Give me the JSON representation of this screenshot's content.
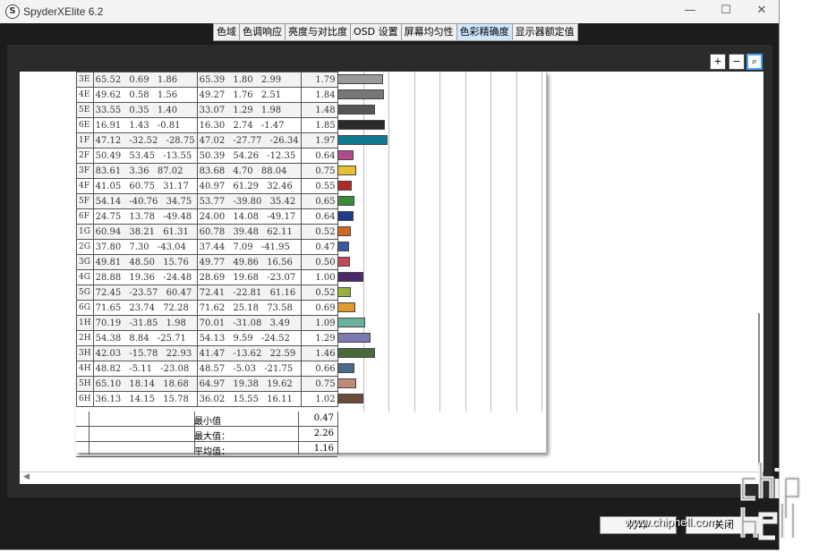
{
  "window": {
    "title": "SpyderXElite 6.2",
    "icon_letter": "S",
    "min": "—",
    "max": "☐",
    "close": "✕"
  },
  "tabs": [
    "色域",
    "色调响应",
    "亮度与对比度",
    "OSD 设置",
    "屏幕均匀性",
    "色彩精确度",
    "显示器额定值"
  ],
  "active_tab": 5,
  "zoom_buttons": [
    "+",
    "−",
    "⌕"
  ],
  "rows": [
    {
      "id": "3E",
      "n1": "65.52 0.69 1.86",
      "n2": "65.39 1.80 2.99",
      "de": "1.79",
      "color": "#9a9a9a"
    },
    {
      "id": "4E",
      "n1": "49.62 0.58 1.56",
      "n2": "49.27 1.76 2.51",
      "de": "1.84",
      "color": "#777777"
    },
    {
      "id": "5E",
      "n1": "33.55 0.35 1.40",
      "n2": "33.07 1.29 1.98",
      "de": "1.48",
      "color": "#555555"
    },
    {
      "id": "6E",
      "n1": "16.91 1.43 -0.81",
      "n2": "16.30 2.74 -1.47",
      "de": "1.85",
      "color": "#2a2a2a"
    },
    {
      "id": "1F",
      "n1": "47.12 -32.52 -28.75",
      "n2": "47.02 -27.77 -26.34",
      "de": "1.97",
      "color": "#0f7a90"
    },
    {
      "id": "2F",
      "n1": "50.49 53.45 -13.55",
      "n2": "50.39 54.26 -12.35",
      "de": "0.64",
      "color": "#b04a8a"
    },
    {
      "id": "3F",
      "n1": "83.61 3.36 87.02",
      "n2": "83.68 4.70 88.04",
      "de": "0.75",
      "color": "#e8c030"
    },
    {
      "id": "4F",
      "n1": "41.05 60.75 31.17",
      "n2": "40.97 61.29 32.46",
      "de": "0.55",
      "color": "#b02a2a"
    },
    {
      "id": "5F",
      "n1": "54.14 -40.76 34.75",
      "n2": "53.77 -39.80 35.42",
      "de": "0.65",
      "color": "#3a8a3a"
    },
    {
      "id": "6F",
      "n1": "24.75 13.78 -49.48",
      "n2": "24.00 14.08 -49.17",
      "de": "0.64",
      "color": "#1f3a8a"
    },
    {
      "id": "1G",
      "n1": "60.94 38.21 61.31",
      "n2": "60.78 39.48 62.11",
      "de": "0.52",
      "color": "#d06a20"
    },
    {
      "id": "2G",
      "n1": "37.80 7.30 -43.04",
      "n2": "37.44 7.09 -41.95",
      "de": "0.47",
      "color": "#3a5aa0"
    },
    {
      "id": "3G",
      "n1": "49.81 48.50 15.76",
      "n2": "49.77 49.86 16.56",
      "de": "0.50",
      "color": "#c04a5a"
    },
    {
      "id": "4G",
      "n1": "28.88 19.36 -24.48",
      "n2": "28.69 19.68 -23.07",
      "de": "1.00",
      "color": "#4a2a6a"
    },
    {
      "id": "5G",
      "n1": "72.45 -23.57 60.47",
      "n2": "72.41 -22.81 61.16",
      "de": "0.52",
      "color": "#9ab040"
    },
    {
      "id": "6G",
      "n1": "71.65 23.74 72.28",
      "n2": "71.62 25.18 73.58",
      "de": "0.69",
      "color": "#e09a30"
    },
    {
      "id": "1H",
      "n1": "70.19 -31.85 1.98",
      "n2": "70.01 -31.08 3.49",
      "de": "1.09",
      "color": "#6ab0a0"
    },
    {
      "id": "2H",
      "n1": "54.38 8.84 -25.71",
      "n2": "54.13 9.59 -24.52",
      "de": "1.29",
      "color": "#7a7ab0"
    },
    {
      "id": "3H",
      "n1": "42.03 -15.78 22.93",
      "n2": "41.47 -13.62 22.59",
      "de": "1.46",
      "color": "#4a6a3a"
    },
    {
      "id": "4H",
      "n1": "48.82 -5.11 -23.08",
      "n2": "48.57 -5.03 -21.75",
      "de": "0.66",
      "color": "#4a6a8a"
    },
    {
      "id": "5H",
      "n1": "65.10 18.14 18.68",
      "n2": "64.97 19.38 19.62",
      "de": "0.75",
      "color": "#c08a7a"
    },
    {
      "id": "6H",
      "n1": "36.13 14.15 15.78",
      "n2": "36.02 15.55 16.11",
      "de": "1.02",
      "color": "#6a4a3a"
    }
  ],
  "summary": [
    {
      "label": "最小值",
      "value": "0.47"
    },
    {
      "label": "最大值：",
      "value": "2.26"
    },
    {
      "label": "平均值：",
      "value": "1.16"
    }
  ],
  "buttons": {
    "print": "打印",
    "close": "关闭"
  },
  "watermark": "www.chiphell.com"
}
